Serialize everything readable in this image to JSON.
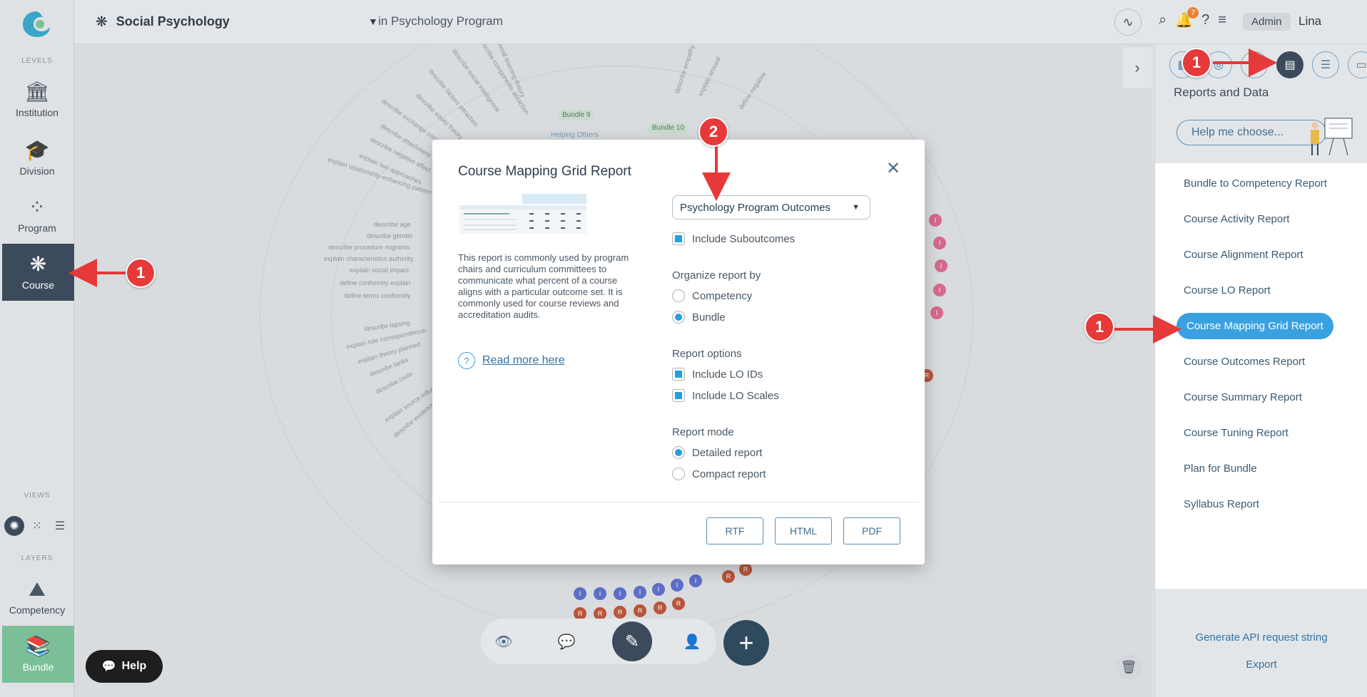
{
  "sidebar": {
    "levels_label": "LEVELS",
    "views_label": "VIEWS",
    "layers_label": "LAYERS",
    "items": [
      {
        "label": "Institution",
        "icon": "institution-icon"
      },
      {
        "label": "Division",
        "icon": "division-icon"
      },
      {
        "label": "Program",
        "icon": "program-icon"
      },
      {
        "label": "Course",
        "icon": "course-icon"
      }
    ],
    "layers": [
      {
        "label": "Competency",
        "icon": "competency-icon"
      },
      {
        "label": "Bundle",
        "icon": "bundle-icon"
      }
    ]
  },
  "header": {
    "course_name": "Social Psychology",
    "program_context": "in Psychology Program",
    "notification_count": "7",
    "role": "Admin",
    "user_name": "Lina"
  },
  "canvas": {
    "bundle_labels": [
      "Bundle 9",
      "Bundle 10"
    ],
    "helping_label": "Helping Others",
    "radial_texts": [
      "describe age",
      "describe gender",
      "describe procedure migrants",
      "explain characteristics authority",
      "explain social impact",
      "define conformity explain",
      "define terms conformity",
      "describe lapsing",
      "explain role correspondence",
      "explain theory planned",
      "describe tanks",
      "describe route",
      "explain source influence",
      "describe evidence",
      "explain relationship-enhancing pattern",
      "explain two approaches",
      "describe negative affect",
      "describe attachment",
      "describe exchange comparison",
      "describe equity theory",
      "describe factors attraction",
      "describe social intelligence",
      "describe components attraction",
      "social learning theory",
      "describe empathy",
      "explain arousal",
      "define negative"
    ],
    "dot_i": "I",
    "dot_r": "R"
  },
  "help_button": "Help",
  "right_panel": {
    "title": "Reports and Data",
    "help_choose": "Help me choose...",
    "reports": [
      "Bundle to Competency Report",
      "Course Activity Report",
      "Course Alignment Report",
      "Course LO Report",
      "Course Mapping Grid Report",
      "Course Outcomes Report",
      "Course Summary Report",
      "Course Tuning Report",
      "Plan for Bundle",
      "Syllabus Report"
    ],
    "active_report_index": 4,
    "generate_api": "Generate API request string",
    "export": "Export"
  },
  "modal": {
    "title": "Course Mapping Grid Report",
    "description": "This report is commonly used by program chairs and curriculum committees to communicate what percent of a course aligns with a particular outcome set. It is commonly used for course reviews and accreditation audits.",
    "read_more": "Read more here",
    "outcome_set": "Psychology Program Outcomes",
    "include_suboutcomes": "Include Suboutcomes",
    "include_suboutcomes_checked": true,
    "organize_label": "Organize report by",
    "organize_options": [
      "Competency",
      "Bundle"
    ],
    "organize_selected": "Bundle",
    "report_options_label": "Report options",
    "report_options": [
      "Include LO IDs",
      "Include LO Scales"
    ],
    "report_mode_label": "Report mode",
    "report_modes": [
      "Detailed report",
      "Compact report"
    ],
    "report_mode_selected": "Detailed report",
    "formats": [
      "RTF",
      "HTML",
      "PDF"
    ]
  },
  "annotations": {
    "callout_1": "1",
    "callout_2": "2",
    "arrow_color": "#e63939"
  },
  "colors": {
    "accent": "#1fa1e3",
    "sidebar_active": "#3c4b5c",
    "bundle_layer": "#7bbf98"
  }
}
